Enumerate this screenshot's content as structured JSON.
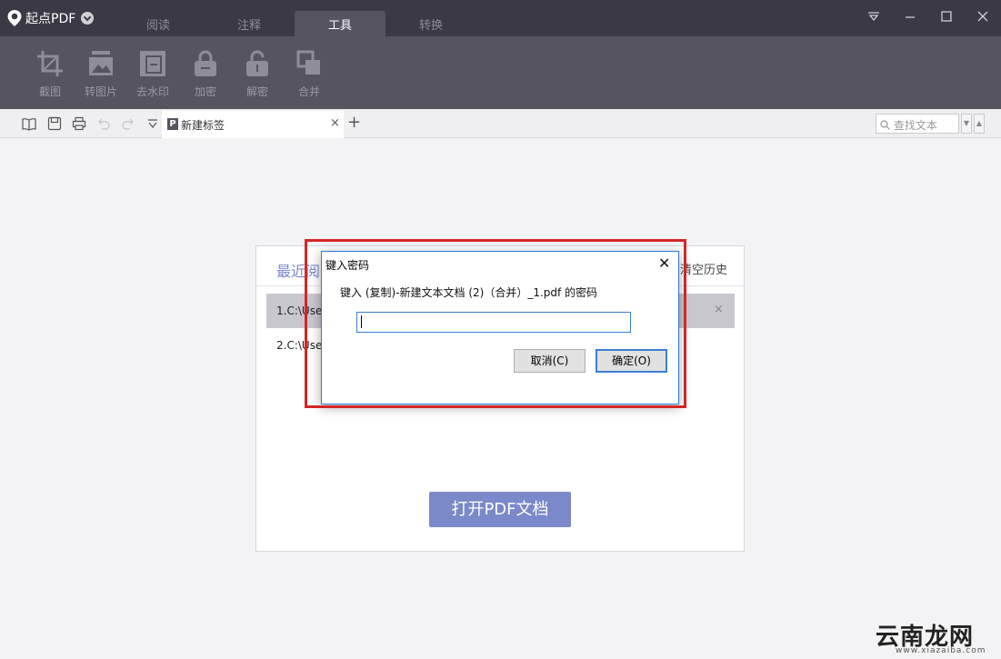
{
  "app": {
    "name": "起点PDF"
  },
  "menu_tabs": [
    {
      "label": "阅读"
    },
    {
      "label": "注释"
    },
    {
      "label": "工具"
    },
    {
      "label": "转换"
    }
  ],
  "toolbar": {
    "items": [
      {
        "label": "截图",
        "icon": "crop-icon"
      },
      {
        "label": "转图片",
        "icon": "image-convert-icon"
      },
      {
        "label": "去水印",
        "icon": "remove-watermark-icon"
      },
      {
        "label": "加密",
        "icon": "lock-icon"
      },
      {
        "label": "解密",
        "icon": "unlock-icon"
      },
      {
        "label": "合并",
        "icon": "merge-icon"
      }
    ]
  },
  "tabstrip": {
    "doc_tab_label": "新建标签",
    "close_symbol": "×",
    "add_symbol": "+",
    "search_placeholder": "查找文本"
  },
  "start_panel": {
    "recent_title": "最近阅",
    "clear_history": "清空历史",
    "recent_files": [
      {
        "label": "1.C:\\User"
      },
      {
        "label": "2.C:\\User"
      }
    ],
    "row_close": "×",
    "open_button": "打开PDF文档"
  },
  "dialog": {
    "title": "键入密码",
    "close_symbol": "✕",
    "prompt": "键入 (复制)-新建文本文档 (2)（合并）_1.pdf 的密码",
    "password_value": "",
    "cancel_label": "取消(C)",
    "ok_label": "确定(O)"
  },
  "watermark": {
    "text": "云南龙网",
    "url": "www.xiazaiba.com"
  },
  "colors": {
    "titlebar": "#3a3944",
    "toolbar": "#55545f",
    "accent": "#7b88c9",
    "highlight_box": "#d32626"
  }
}
